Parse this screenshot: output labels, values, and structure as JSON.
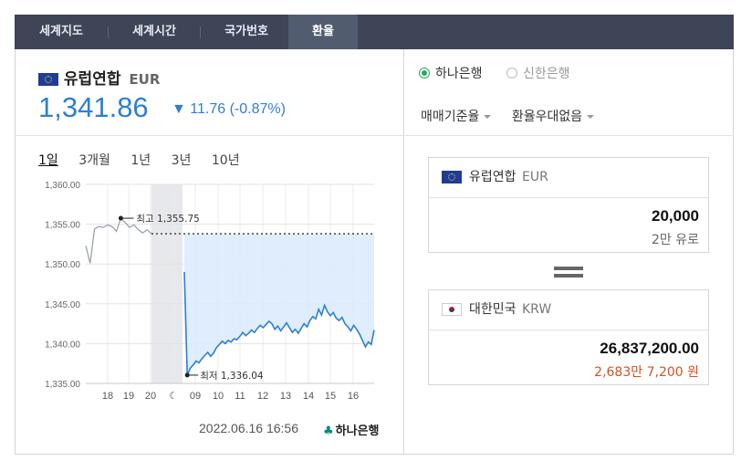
{
  "tabs": [
    "세계지도",
    "세계시간",
    "국가번호",
    "환율"
  ],
  "active_tab": "환율",
  "currency": {
    "name": "유럽연합",
    "code": "EUR"
  },
  "rate": "1,341.86",
  "change": {
    "arrow": "▼",
    "text": "11.76 (-0.87%)"
  },
  "periods": [
    "1일",
    "3개월",
    "1년",
    "3년",
    "10년"
  ],
  "active_period": "1일",
  "chart_data": {
    "type": "line",
    "y_ticks": [
      "1,360.00",
      "1,355.00",
      "1,350.00",
      "1,345.00",
      "1,340.00",
      "1,335.00"
    ],
    "ylim": [
      1335,
      1360
    ],
    "x_ticks": [
      "18",
      "19",
      "20",
      "☾",
      "09",
      "10",
      "11",
      "12",
      "13",
      "14",
      "15",
      "16"
    ],
    "high": {
      "label": "최고 1,355.75",
      "value": 1355.75
    },
    "low": {
      "label": "최저 1,336.04",
      "value": 1336.04
    },
    "previous_close_level": 1353.8,
    "series": [
      {
        "values": [
          1352.3,
          1350.1,
          1354.4,
          1354.7,
          1354.6,
          1354.9,
          1354.7,
          1354.1,
          1355.75,
          1355.2,
          1354.6,
          1354.9,
          1354.3,
          1353.9,
          1354.3,
          1353.8
        ]
      },
      {
        "values": [
          1349.0,
          1336.04,
          1336.9,
          1337.3,
          1337.8,
          1337.6,
          1338.1,
          1338.5,
          1338.9,
          1338.4,
          1338.8,
          1339.5,
          1339.9,
          1340.3,
          1340.0,
          1340.4,
          1340.2,
          1340.6,
          1340.5,
          1340.9,
          1341.4,
          1341.0,
          1341.3,
          1341.7,
          1341.4,
          1341.9,
          1342.3,
          1342.0,
          1342.4,
          1342.8,
          1342.5,
          1341.8,
          1342.2,
          1341.6,
          1342.1,
          1342.6,
          1342.0,
          1341.4,
          1341.8,
          1341.3,
          1341.9,
          1342.5,
          1342.1,
          1342.9,
          1343.4,
          1343.1,
          1344.3,
          1343.6,
          1344.8,
          1344.0,
          1343.5,
          1343.9,
          1343.2,
          1342.9,
          1343.3,
          1342.5,
          1342.1,
          1341.6,
          1342.3,
          1341.8,
          1341.2,
          1340.4,
          1339.6,
          1340.2,
          1339.9,
          1341.7
        ]
      }
    ]
  },
  "timestamp": "2022.06.16 16:56",
  "bank_logo_text": "하나은행",
  "banks": [
    {
      "label": "하나은행",
      "selected": true
    },
    {
      "label": "신한은행",
      "selected": false
    }
  ],
  "dropdowns": [
    "매매기준율",
    "환율우대없음"
  ],
  "from": {
    "name": "유럽연합",
    "code": "EUR",
    "amount": "20,000",
    "amount_text": "2만 유로"
  },
  "to": {
    "name": "대한민국",
    "code": "KRW",
    "amount": "26,837,200.00",
    "amount_text": "2,683만 7,200 원"
  },
  "colors": {
    "accent": "#2c7fd6",
    "area": "#dbeafb",
    "tab_bar": "#3d4557",
    "radio_on": "#27a85b",
    "won_text": "#d9501e"
  }
}
